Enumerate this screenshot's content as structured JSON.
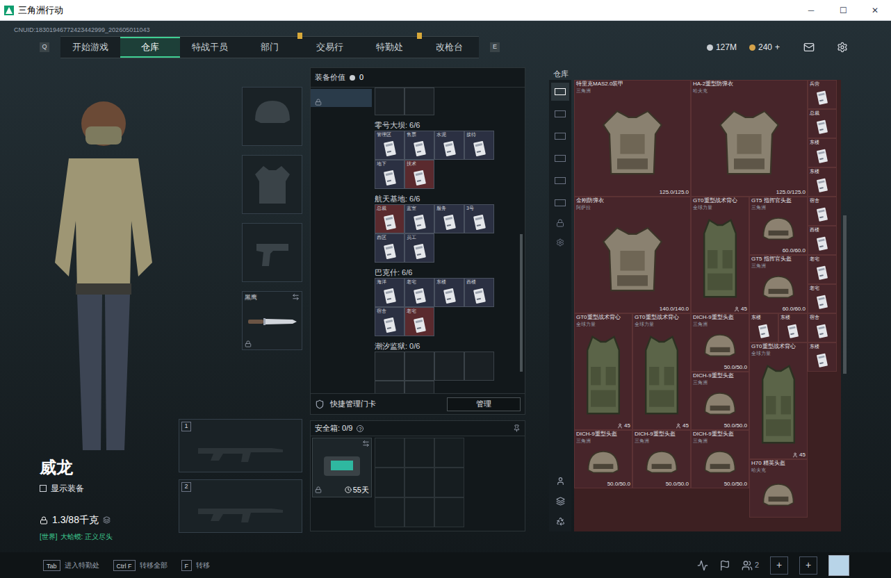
{
  "window": {
    "title": "三角洲行动",
    "controls": [
      "─",
      "☐",
      "✕"
    ]
  },
  "uid": "CNUID:18301946772423442999_202605011043",
  "nav": {
    "prev_key": "Q",
    "next_key": "E",
    "tabs": [
      {
        "label": "开始游戏",
        "selected": false,
        "badge": false
      },
      {
        "label": "仓库",
        "selected": true,
        "badge": false
      },
      {
        "label": "特战干员",
        "selected": false,
        "badge": false
      },
      {
        "label": "部门",
        "selected": false,
        "badge": true
      },
      {
        "label": "交易行",
        "selected": false,
        "badge": false
      },
      {
        "label": "特勤处",
        "selected": false,
        "badge": true
      },
      {
        "label": "改枪台",
        "selected": false,
        "badge": false
      }
    ]
  },
  "currency": {
    "coins": "127M",
    "gold": "240",
    "gold_add": "+"
  },
  "operator": {
    "name": "威龙",
    "show_gear": {
      "label": "显示装备",
      "checked": false
    },
    "weight": "1.3/88千克",
    "chat": {
      "channel": "[世界]",
      "text": "大蛤蟆: 正义尽头"
    }
  },
  "gear_slots": [
    {
      "kind": "helmet",
      "filled": false
    },
    {
      "kind": "armor",
      "filled": false
    },
    {
      "kind": "pistol",
      "filled": false
    },
    {
      "kind": "melee",
      "filled": true,
      "label": "黑鹰",
      "locked": true
    }
  ],
  "weapon_slots": [
    {
      "number": "1"
    },
    {
      "number": "2"
    }
  ],
  "loadout": {
    "value_label": "装备价值",
    "value": "0",
    "key_categories": [
      {
        "selected": true,
        "locked": true
      }
    ],
    "key_sections": [
      {
        "title": "零号大坝: 6/6",
        "cards": [
          {
            "label": "管理区",
            "color": "#2b3042"
          },
          {
            "label": "售票",
            "color": "#2b3042"
          },
          {
            "label": "水泥",
            "color": "#2b3042"
          },
          {
            "label": "接待",
            "color": "#2b3042"
          },
          {
            "label": "地下",
            "color": "#2b3042"
          },
          {
            "label": "技术",
            "color": "#5a2a2e"
          }
        ]
      },
      {
        "title": "航天基地: 6/6",
        "cards": [
          {
            "label": "总裁",
            "color": "#5a2a2e"
          },
          {
            "label": "蓝室",
            "color": "#2b3042"
          },
          {
            "label": "服务",
            "color": "#2b3042"
          },
          {
            "label": "3号",
            "color": "#2b3042"
          },
          {
            "label": "西区",
            "color": "#2b3042"
          },
          {
            "label": "员工",
            "color": "#2b3042"
          }
        ]
      },
      {
        "title": "巴克什: 6/6",
        "cards": [
          {
            "label": "海洋",
            "color": "#2b3042"
          },
          {
            "label": "老宅",
            "color": "#2b3042"
          },
          {
            "label": "东楼",
            "color": "#2b3042"
          },
          {
            "label": "西楼",
            "color": "#2b3042"
          },
          {
            "label": "宿舍",
            "color": "#2b3042"
          },
          {
            "label": "老宅",
            "color": "#5a2a2e"
          }
        ]
      },
      {
        "title": "潮汐监狱: 0/6",
        "cards": []
      }
    ],
    "quick_manage": {
      "label": "快捷管理门卡",
      "button": "管理"
    }
  },
  "safe_box": {
    "title": "安全箱: 0/9",
    "help": "?",
    "duration": "55天",
    "locked": true
  },
  "warehouse": {
    "title": "仓库",
    "tabs": [
      {
        "selected": true
      },
      {
        "selected": false
      },
      {
        "selected": false
      },
      {
        "selected": false
      },
      {
        "selected": false
      },
      {
        "selected": false
      }
    ],
    "items": [
      {
        "kind": "armor",
        "name": "特里克MAS2.0装甲",
        "maker": "三角洲",
        "value": "125.0/125.0"
      },
      {
        "kind": "armor",
        "name": "HA-2重型防弹衣",
        "maker": "哈夫克",
        "value": "125.0/125.0"
      },
      {
        "kind": "card",
        "name": "兵营"
      },
      {
        "kind": "card",
        "name": "总裁"
      },
      {
        "kind": "card",
        "name": "东楼"
      },
      {
        "kind": "card",
        "name": "东楼"
      },
      {
        "kind": "armor",
        "name": "金刚防弹衣",
        "maker": "阿萨拉",
        "value": "140.0/140.0"
      },
      {
        "kind": "rig",
        "name": "GT0重型战术背心",
        "maker": "全球力量",
        "value": "45"
      },
      {
        "kind": "helmet",
        "name": "GT5 指挥官头盔",
        "maker": "三角洲",
        "value": "60.0/60.0"
      },
      {
        "kind": "helmet",
        "name": "GT5 指挥官头盔",
        "maker": "三角洲",
        "value": "60.0/60.0"
      },
      {
        "kind": "card",
        "name": "宿舍"
      },
      {
        "kind": "card",
        "name": "西楼"
      },
      {
        "kind": "rig",
        "name": "GT0重型战术背心",
        "maker": "全球力量",
        "value": "45"
      },
      {
        "kind": "card",
        "name": "老宅"
      },
      {
        "kind": "card",
        "name": "老宅"
      },
      {
        "kind": "rig",
        "name": "GT0重型战术背心",
        "maker": "全球力量",
        "value": "45"
      },
      {
        "kind": "helmet",
        "name": "DICH-9重型头盔",
        "maker": "三角洲",
        "value": "50.0/50.0"
      },
      {
        "kind": "card",
        "name": "东楼"
      },
      {
        "kind": "card",
        "name": "东楼"
      },
      {
        "kind": "rig",
        "name": "GT0重型战术背心",
        "maker": "全球力量",
        "value": "45"
      },
      {
        "kind": "helmet",
        "name": "DICH-9重型头盔",
        "maker": "三角洲",
        "value": "50.0/50.0"
      },
      {
        "kind": "helmet",
        "name": "DICH-9重型头盔",
        "maker": "三角洲",
        "value": "50.0/50.0"
      },
      {
        "kind": "helmet",
        "name": "DICH-9重型头盔",
        "maker": "三角洲",
        "value": "50.0/50.0"
      },
      {
        "kind": "helmet",
        "name": "DICH-9重型头盔",
        "maker": "三角洲",
        "value": "50.0/50.0"
      },
      {
        "kind": "helmet",
        "name": "H70 精英头盔",
        "maker": "哈夫克"
      },
      {
        "kind": "card",
        "name": "宿舍"
      },
      {
        "kind": "card",
        "name": "东楼"
      }
    ]
  },
  "bottom_bar": {
    "hints": [
      {
        "key": "Tab",
        "label": "进入特勤处"
      },
      {
        "key": "Ctrl F",
        "label": "转移全部"
      },
      {
        "key": "F",
        "label": "转移"
      }
    ],
    "friends": "2",
    "add_buttons": [
      "+",
      "+"
    ]
  }
}
